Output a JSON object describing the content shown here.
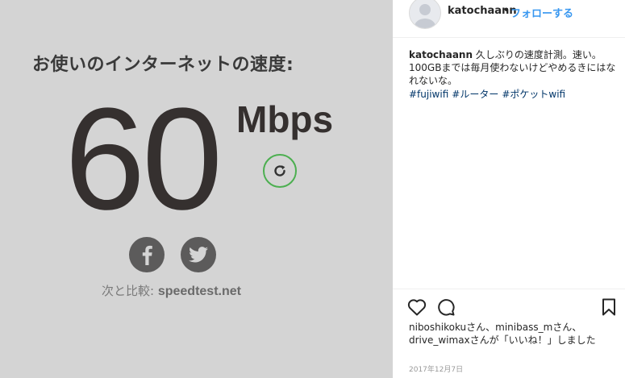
{
  "photo": {
    "title": "お使いのインターネットの速度:",
    "speed": "60",
    "unit": "Mbps",
    "compare_prefix": "次と比較: ",
    "compare_site": "speedtest.net",
    "accent_color": "#4caf50",
    "icons": [
      "refresh-icon",
      "facebook-icon",
      "twitter-icon"
    ]
  },
  "post": {
    "username": "katochaann",
    "separator": "•",
    "follow_label": "フォローする",
    "caption_user": "katochaann",
    "caption_text": " 久しぶりの速度計測。速い。100GBまでは毎月使わないけどやめるきにはなれないな。",
    "hashtags": [
      "#fujiwifi",
      "#ルーター",
      "#ポケットwifi"
    ],
    "likes_text": "niboshikokuさん、minibass_mさん、drive_wimaxさんが「いいね！」しました",
    "date": "2017年12月7日",
    "link_color": "#3897f0",
    "tag_color": "#003569"
  }
}
